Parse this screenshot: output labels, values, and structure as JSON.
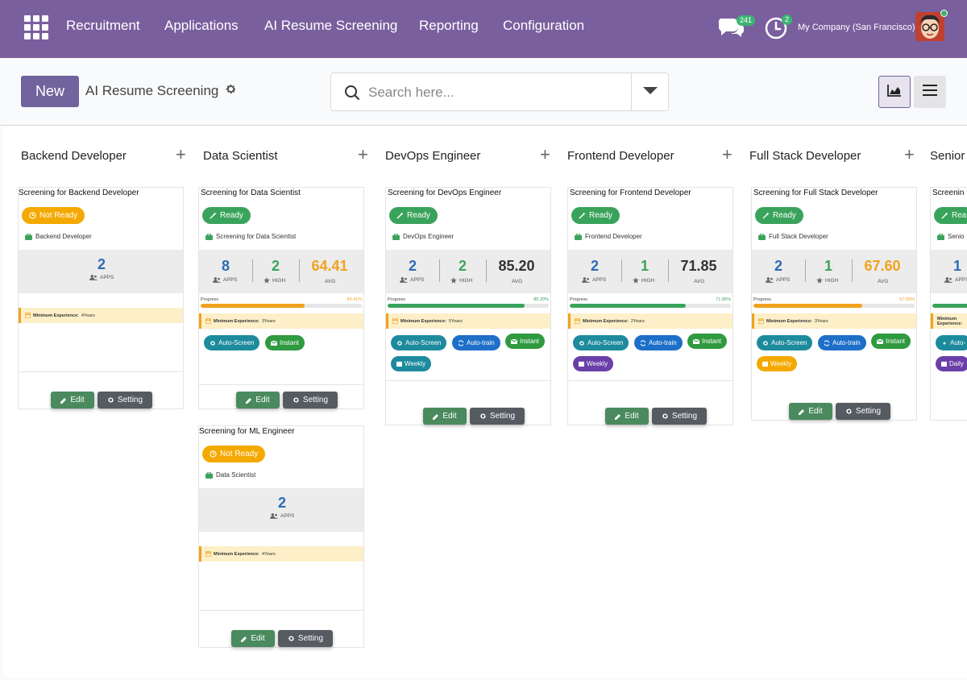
{
  "nav": {
    "items": [
      "Recruitment",
      "Applications",
      "AI Resume Screening",
      "Reporting",
      "Configuration"
    ],
    "messages_count": "241",
    "activity_count": "2",
    "company": "My Company (San Francisco)"
  },
  "control": {
    "new_label": "New",
    "breadcrumb": "AI Resume Screening",
    "search_placeholder": "Search here..."
  },
  "labels": {
    "apps": "APPS",
    "high": "HIGH",
    "avg": "AVG",
    "progress": "Progress",
    "min_exp": "Minimum Experience:",
    "edit": "Edit",
    "setting": "Setting"
  },
  "columns": [
    {
      "title": "Backend Developer"
    },
    {
      "title": "Data Scientist"
    },
    {
      "title": "DevOps Engineer"
    },
    {
      "title": "Frontend Developer"
    },
    {
      "title": "Full Stack Developer"
    },
    {
      "title": "Senior"
    }
  ],
  "cards": [
    {
      "title": "Screening for Backend Developer",
      "status": "Not Ready",
      "role": "Backend Developer",
      "apps": "2",
      "min_exp": "4Years"
    },
    {
      "title": "Screening for Data Scientist",
      "status": "Ready",
      "role": "Screening for Data Scientist",
      "apps": "8",
      "high": "2",
      "avg": "64.41",
      "progress_pct": "64.41%",
      "progress": 64.41,
      "min_exp": "3Years",
      "tags": [
        "Auto-Screen",
        "Instant"
      ]
    },
    {
      "title": "Screening for ML Engineer",
      "status": "Not Ready",
      "role": "Data Scientist",
      "apps": "2",
      "min_exp": "4Years"
    },
    {
      "title": "Screening for DevOps Engineer",
      "status": "Ready",
      "role": "DevOps Engineer",
      "apps": "2",
      "high": "2",
      "avg": "85.20",
      "progress_pct": "85.20%",
      "progress": 85.2,
      "min_exp": "5Years",
      "tags": [
        "Auto-Screen",
        "Auto-train",
        "Instant",
        "Weekly"
      ]
    },
    {
      "title": "Screening for Frontend Developer",
      "status": "Ready",
      "role": "Frontend Developer",
      "apps": "2",
      "high": "1",
      "avg": "71.85",
      "progress_pct": "71.85%",
      "progress": 71.85,
      "min_exp": "2Years",
      "tags": [
        "Auto-Screen",
        "Auto-train",
        "Instant",
        "Weekly"
      ]
    },
    {
      "title": "Screening for Full Stack Developer",
      "status": "Ready",
      "role": "Full Stack Developer",
      "apps": "2",
      "high": "1",
      "avg": "67.60",
      "progress_pct": "67.60%",
      "progress": 67.6,
      "min_exp": "3Years",
      "tags": [
        "Auto-Screen",
        "Auto-train",
        "Instant",
        "Weekly"
      ]
    },
    {
      "title": "Screenin",
      "status": "Rea",
      "role": "Senio",
      "apps": "1",
      "tags": [
        "Auto-",
        "Daily"
      ]
    }
  ],
  "colors": {
    "nav_bg": "#7a5f9e",
    "primary": "#71639e",
    "blue": "#2d6cb5",
    "green": "#3aa35b",
    "orange": "#f0a21c"
  }
}
